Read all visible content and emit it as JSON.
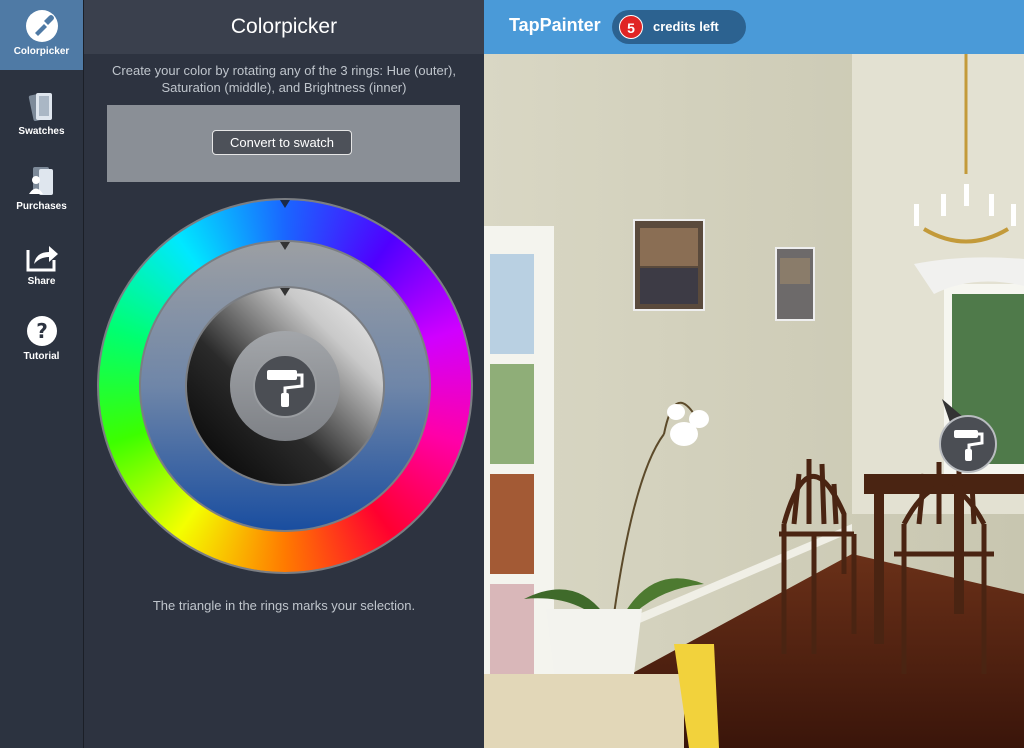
{
  "nav": {
    "items": [
      {
        "label": "Colorpicker",
        "icon": "eyedropper-icon",
        "active": true
      },
      {
        "label": "Swatches",
        "icon": "swatches-icon",
        "active": false
      },
      {
        "label": "Purchases",
        "icon": "purchases-icon",
        "active": false
      },
      {
        "label": "Share",
        "icon": "share-icon",
        "active": false
      },
      {
        "label": "Tutorial",
        "icon": "help-icon",
        "active": false
      }
    ]
  },
  "panel": {
    "title": "Colorpicker",
    "instructions": "Create your color by rotating any of the 3 rings: Hue (outer), Saturation (middle), and Brightness (inner)",
    "convert_label": "Convert to swatch",
    "hint": "The triangle in the rings marks your selection.",
    "preview_color": "#8a8f96"
  },
  "topbar": {
    "app_title": "TapPainter",
    "credits_count": "5",
    "credits_label": "credits left"
  },
  "colors": {
    "accent": "#4a9ad8",
    "nav_active": "#4f7aa5",
    "credit_badge": "#e02424"
  }
}
